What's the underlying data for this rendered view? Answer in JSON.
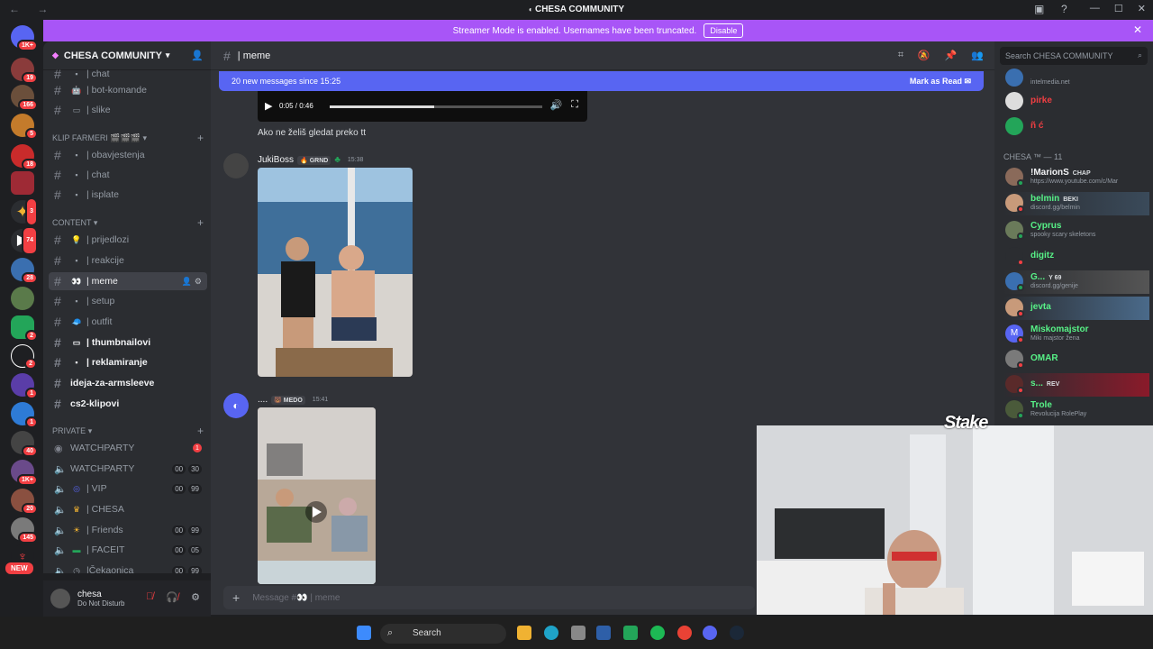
{
  "window": {
    "title": "CHESA COMMUNITY",
    "nav_icons": "← →"
  },
  "banner": {
    "text": "Streamer Mode is enabled. Usernames have been truncated.",
    "disable_label": "Disable"
  },
  "servers": {
    "badges": [
      "1K+",
      "19",
      "166",
      "5",
      "18",
      "3",
      "74",
      "28",
      "2",
      "2",
      "1",
      "1",
      "40",
      "1K+",
      "20",
      "145"
    ],
    "new_label": "NEW"
  },
  "guild": {
    "name": "CHESA COMMUNITY",
    "categories": {
      "klip_farmeri": "KLIP FARMERI 🎬🎬🎬",
      "content": "CONTENT",
      "private": "PRIVATE"
    },
    "channels": [
      {
        "label": "| chat",
        "emoji": "▪",
        "key": "c0"
      },
      {
        "label": "| bot-komande",
        "emoji": "🤖",
        "key": "c1"
      },
      {
        "label": "| slike",
        "emoji": "▭",
        "key": "c2"
      },
      {
        "label": "| obavjestenja",
        "emoji": "▪",
        "key": "c3"
      },
      {
        "label": "| chat",
        "emoji": "▪",
        "key": "c4"
      },
      {
        "label": "| isplate",
        "emoji": "▪",
        "key": "c5"
      },
      {
        "label": "| prijedlozi",
        "emoji": "💡",
        "key": "c6"
      },
      {
        "label": "| reakcije",
        "emoji": "▪",
        "key": "c7"
      },
      {
        "label": "| meme",
        "emoji": "👀",
        "key": "c8"
      },
      {
        "label": "| setup",
        "emoji": "▪",
        "key": "c9"
      },
      {
        "label": "| outfit",
        "emoji": "🧢",
        "key": "c10"
      },
      {
        "label": "| thumbnailovi",
        "emoji": "▭",
        "key": "c11"
      },
      {
        "label": "| reklamiranje",
        "emoji": "▪",
        "key": "c12"
      },
      {
        "label": "ideja-za-armsleeve",
        "emoji": "",
        "key": "c13"
      },
      {
        "label": "cs2-klipovi",
        "emoji": "",
        "key": "c14"
      }
    ],
    "voice": [
      {
        "label": "WATCHPARTY",
        "badge": "1"
      },
      {
        "label": "WATCHPARTY",
        "c1": "00",
        "c2": "30"
      },
      {
        "label": "| VIP",
        "c1": "00",
        "c2": "99"
      },
      {
        "label": "| CHESA"
      },
      {
        "label": "| Friends",
        "c1": "00",
        "c2": "99"
      },
      {
        "label": "| FACEIT",
        "c1": "00",
        "c2": "05"
      },
      {
        "label": "|Čekaonica",
        "c1": "00",
        "c2": "99"
      }
    ]
  },
  "user": {
    "name": "chesa",
    "status": "Do Not Disturb"
  },
  "channel": {
    "name": "| meme",
    "new_messages": "20 new messages since 15:25",
    "mark_read": "Mark as Read",
    "video_time": "0:05 / 0:46",
    "video_progress": 0.49,
    "text_line": "Ako ne želiš gledat preko tt",
    "composer_placeholder": "Message #👀 | meme"
  },
  "messages": [
    {
      "author": "JukiBoss",
      "tag": "GRND",
      "time": "15:38"
    },
    {
      "author": "....",
      "tag": "MEDO",
      "time": "15:41"
    }
  ],
  "members": {
    "search_placeholder": "Search CHESA COMMUNITY",
    "top": [
      {
        "name": "",
        "sub": "intelmedia.net",
        "color": "#f23f43"
      },
      {
        "name": "pirke",
        "sub": "",
        "color": "#f23f43"
      },
      {
        "name": "ñ ć",
        "sub": "",
        "color": "#f23f43"
      }
    ],
    "category": "CHESA ™ — 11",
    "list": [
      {
        "name": "!MarionS",
        "tag": "CHAP",
        "sub": "https://www.youtube.com/c/Mar",
        "color": "#f2f3f5"
      },
      {
        "name": "belmin",
        "tag": "BEKI",
        "sub": "discord.gg/belmin",
        "color": "#57f287"
      },
      {
        "name": "Cyprus",
        "tag": "",
        "sub": "spooky scary skeletons",
        "color": "#57f287"
      },
      {
        "name": "digitz",
        "tag": "",
        "sub": "",
        "color": "#57f287"
      },
      {
        "name": "G...",
        "tag": "Y 69",
        "sub": "discord.gg/genije",
        "color": "#57f287"
      },
      {
        "name": "jevta",
        "tag": "",
        "sub": "",
        "color": "#57f287"
      },
      {
        "name": "Miskomajstor",
        "tag": "",
        "sub": "Miki majstor žena",
        "color": "#57f287"
      },
      {
        "name": "OMAR",
        "tag": "",
        "sub": "",
        "color": "#57f287"
      },
      {
        "name": "s...",
        "tag": "REV",
        "sub": "",
        "color": "#57f287"
      },
      {
        "name": "Trole",
        "tag": "",
        "sub": "Revolucija RolePlay",
        "color": "#57f287"
      }
    ]
  },
  "overlay": {
    "stake": "Stake"
  },
  "taskbar": {
    "search_label": "Search"
  },
  "colors": {
    "accent": "#5865f2",
    "streamer_banner": "#a855f7",
    "online": "#57f287",
    "dnd": "#f23f43"
  }
}
